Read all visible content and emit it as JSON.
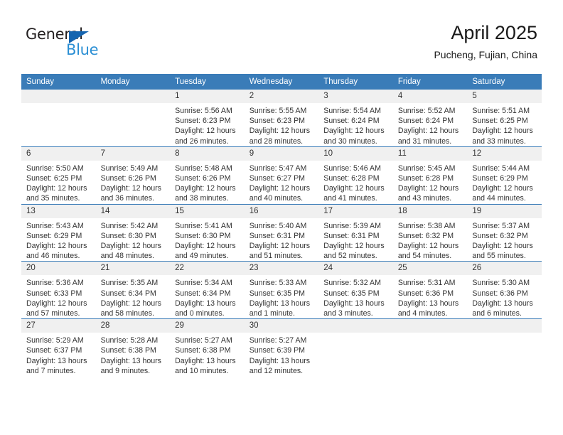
{
  "brand": {
    "name_part1": "General",
    "name_part2": "Blue",
    "accent_color": "#2b8fd4",
    "triangle_color": "#1565b0"
  },
  "header": {
    "title": "April 2025",
    "subtitle": "Pucheng, Fujian, China"
  },
  "theme": {
    "header_row_color": "#3a7cb8",
    "daynum_band_color": "#f0f0f0",
    "row_separator_color": "#3a7cb8"
  },
  "weekdays": [
    "Sunday",
    "Monday",
    "Tuesday",
    "Wednesday",
    "Thursday",
    "Friday",
    "Saturday"
  ],
  "weeks": [
    [
      {
        "day": "",
        "sunrise": "",
        "sunset": "",
        "daylight": ""
      },
      {
        "day": "",
        "sunrise": "",
        "sunset": "",
        "daylight": ""
      },
      {
        "day": "1",
        "sunrise": "Sunrise: 5:56 AM",
        "sunset": "Sunset: 6:23 PM",
        "daylight": "Daylight: 12 hours and 26 minutes."
      },
      {
        "day": "2",
        "sunrise": "Sunrise: 5:55 AM",
        "sunset": "Sunset: 6:23 PM",
        "daylight": "Daylight: 12 hours and 28 minutes."
      },
      {
        "day": "3",
        "sunrise": "Sunrise: 5:54 AM",
        "sunset": "Sunset: 6:24 PM",
        "daylight": "Daylight: 12 hours and 30 minutes."
      },
      {
        "day": "4",
        "sunrise": "Sunrise: 5:52 AM",
        "sunset": "Sunset: 6:24 PM",
        "daylight": "Daylight: 12 hours and 31 minutes."
      },
      {
        "day": "5",
        "sunrise": "Sunrise: 5:51 AM",
        "sunset": "Sunset: 6:25 PM",
        "daylight": "Daylight: 12 hours and 33 minutes."
      }
    ],
    [
      {
        "day": "6",
        "sunrise": "Sunrise: 5:50 AM",
        "sunset": "Sunset: 6:25 PM",
        "daylight": "Daylight: 12 hours and 35 minutes."
      },
      {
        "day": "7",
        "sunrise": "Sunrise: 5:49 AM",
        "sunset": "Sunset: 6:26 PM",
        "daylight": "Daylight: 12 hours and 36 minutes."
      },
      {
        "day": "8",
        "sunrise": "Sunrise: 5:48 AM",
        "sunset": "Sunset: 6:26 PM",
        "daylight": "Daylight: 12 hours and 38 minutes."
      },
      {
        "day": "9",
        "sunrise": "Sunrise: 5:47 AM",
        "sunset": "Sunset: 6:27 PM",
        "daylight": "Daylight: 12 hours and 40 minutes."
      },
      {
        "day": "10",
        "sunrise": "Sunrise: 5:46 AM",
        "sunset": "Sunset: 6:28 PM",
        "daylight": "Daylight: 12 hours and 41 minutes."
      },
      {
        "day": "11",
        "sunrise": "Sunrise: 5:45 AM",
        "sunset": "Sunset: 6:28 PM",
        "daylight": "Daylight: 12 hours and 43 minutes."
      },
      {
        "day": "12",
        "sunrise": "Sunrise: 5:44 AM",
        "sunset": "Sunset: 6:29 PM",
        "daylight": "Daylight: 12 hours and 44 minutes."
      }
    ],
    [
      {
        "day": "13",
        "sunrise": "Sunrise: 5:43 AM",
        "sunset": "Sunset: 6:29 PM",
        "daylight": "Daylight: 12 hours and 46 minutes."
      },
      {
        "day": "14",
        "sunrise": "Sunrise: 5:42 AM",
        "sunset": "Sunset: 6:30 PM",
        "daylight": "Daylight: 12 hours and 48 minutes."
      },
      {
        "day": "15",
        "sunrise": "Sunrise: 5:41 AM",
        "sunset": "Sunset: 6:30 PM",
        "daylight": "Daylight: 12 hours and 49 minutes."
      },
      {
        "day": "16",
        "sunrise": "Sunrise: 5:40 AM",
        "sunset": "Sunset: 6:31 PM",
        "daylight": "Daylight: 12 hours and 51 minutes."
      },
      {
        "day": "17",
        "sunrise": "Sunrise: 5:39 AM",
        "sunset": "Sunset: 6:31 PM",
        "daylight": "Daylight: 12 hours and 52 minutes."
      },
      {
        "day": "18",
        "sunrise": "Sunrise: 5:38 AM",
        "sunset": "Sunset: 6:32 PM",
        "daylight": "Daylight: 12 hours and 54 minutes."
      },
      {
        "day": "19",
        "sunrise": "Sunrise: 5:37 AM",
        "sunset": "Sunset: 6:32 PM",
        "daylight": "Daylight: 12 hours and 55 minutes."
      }
    ],
    [
      {
        "day": "20",
        "sunrise": "Sunrise: 5:36 AM",
        "sunset": "Sunset: 6:33 PM",
        "daylight": "Daylight: 12 hours and 57 minutes."
      },
      {
        "day": "21",
        "sunrise": "Sunrise: 5:35 AM",
        "sunset": "Sunset: 6:34 PM",
        "daylight": "Daylight: 12 hours and 58 minutes."
      },
      {
        "day": "22",
        "sunrise": "Sunrise: 5:34 AM",
        "sunset": "Sunset: 6:34 PM",
        "daylight": "Daylight: 13 hours and 0 minutes."
      },
      {
        "day": "23",
        "sunrise": "Sunrise: 5:33 AM",
        "sunset": "Sunset: 6:35 PM",
        "daylight": "Daylight: 13 hours and 1 minute."
      },
      {
        "day": "24",
        "sunrise": "Sunrise: 5:32 AM",
        "sunset": "Sunset: 6:35 PM",
        "daylight": "Daylight: 13 hours and 3 minutes."
      },
      {
        "day": "25",
        "sunrise": "Sunrise: 5:31 AM",
        "sunset": "Sunset: 6:36 PM",
        "daylight": "Daylight: 13 hours and 4 minutes."
      },
      {
        "day": "26",
        "sunrise": "Sunrise: 5:30 AM",
        "sunset": "Sunset: 6:36 PM",
        "daylight": "Daylight: 13 hours and 6 minutes."
      }
    ],
    [
      {
        "day": "27",
        "sunrise": "Sunrise: 5:29 AM",
        "sunset": "Sunset: 6:37 PM",
        "daylight": "Daylight: 13 hours and 7 minutes."
      },
      {
        "day": "28",
        "sunrise": "Sunrise: 5:28 AM",
        "sunset": "Sunset: 6:38 PM",
        "daylight": "Daylight: 13 hours and 9 minutes."
      },
      {
        "day": "29",
        "sunrise": "Sunrise: 5:27 AM",
        "sunset": "Sunset: 6:38 PM",
        "daylight": "Daylight: 13 hours and 10 minutes."
      },
      {
        "day": "30",
        "sunrise": "Sunrise: 5:27 AM",
        "sunset": "Sunset: 6:39 PM",
        "daylight": "Daylight: 13 hours and 12 minutes."
      },
      {
        "day": "",
        "sunrise": "",
        "sunset": "",
        "daylight": ""
      },
      {
        "day": "",
        "sunrise": "",
        "sunset": "",
        "daylight": ""
      },
      {
        "day": "",
        "sunrise": "",
        "sunset": "",
        "daylight": ""
      }
    ]
  ]
}
